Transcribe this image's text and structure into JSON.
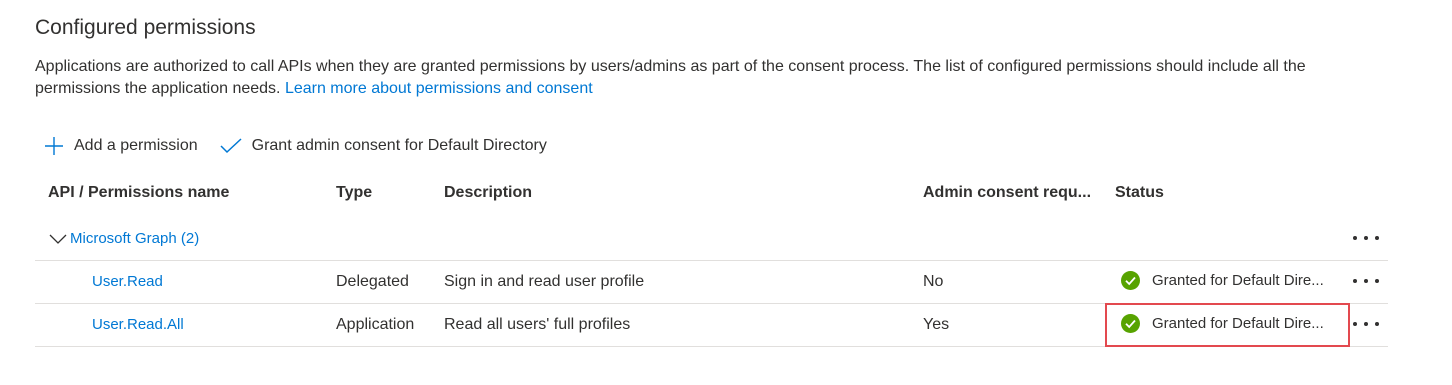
{
  "section": {
    "title": "Configured permissions",
    "description": "Applications are authorized to call APIs when they are granted permissions by users/admins as part of the consent process. The list of configured permissions should include all the permissions the application needs.",
    "learn_more_link": "Learn more about permissions and consent"
  },
  "toolbar": {
    "add_permission_label": "Add a permission",
    "grant_consent_label": "Grant admin consent for Default Directory"
  },
  "table": {
    "columns": [
      "API / Permissions name",
      "Type",
      "Description",
      "Admin consent requ...",
      "Status"
    ],
    "group": {
      "label": "Microsoft Graph (2)",
      "expanded": true
    },
    "rows": [
      {
        "name": "User.Read",
        "type": "Delegated",
        "description": "Sign in and read user profile",
        "admin_consent": "No",
        "status": "Granted for Default Dire..."
      },
      {
        "name": "User.Read.All",
        "type": "Application",
        "description": "Read all users' full profiles",
        "admin_consent": "Yes",
        "status": "Granted for Default Dire...",
        "highlighted": true
      }
    ]
  },
  "colors": {
    "accent": "#0078d4",
    "success": "#57a300",
    "highlight_border": "#e3494f",
    "text": "#323130",
    "divider": "#e1dfdd"
  },
  "icons": {
    "add": "plus-icon",
    "grant": "checkmark-icon",
    "expand": "chevron-down-icon",
    "status": "success-check-circle-icon",
    "more": "more-ellipsis-icon"
  }
}
